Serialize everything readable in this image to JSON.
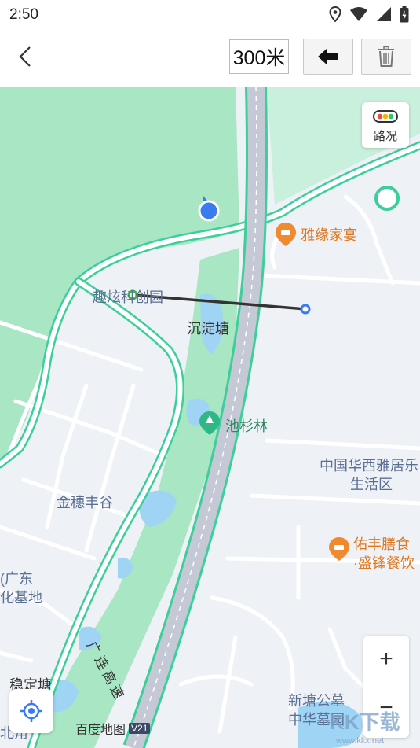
{
  "status_bar": {
    "time": "2:50"
  },
  "toolbar": {
    "distance": "300米"
  },
  "map": {
    "labels": {
      "yayuan": "雅缘家宴",
      "quxuan": "趣炫科创园",
      "chendiantang": "沉淀塘",
      "chishanlin": "池杉林",
      "huaxi_line1": "中国华西雅居乐",
      "huaxi_line2": "生活区",
      "jinsui": "金穗丰谷",
      "youfeng_line1": "佑丰膳食",
      "youfeng_line2": "·盛锋餐饮",
      "guangdong_line1": "(广东",
      "guangdong_line2": "化基地",
      "guanglian": "广连高速",
      "wendingtang": "稳定塘",
      "beijiao": "北角",
      "xintang_line1": "新塘公墓",
      "xintang_line2": "中华墓园"
    },
    "traffic_label": "路况",
    "logo_text": "百度地图",
    "logo_version": "V21",
    "watermark": "KK下载",
    "watermark_url": "www.kkx.net"
  },
  "controls": {
    "zoom_in": "+",
    "zoom_out": "−"
  },
  "colors": {
    "park": "#a8e6c4",
    "road_outline": "#3ccf9a",
    "highway": "#c5c9d6",
    "marker": "#3a7cf0",
    "poi_orange": "#f08a30"
  },
  "icons": [
    "back-arrow-icon",
    "undo-arrow-icon",
    "trash-icon",
    "traffic-light-icon",
    "locate-icon",
    "location-icon",
    "wifi-icon",
    "signal-icon",
    "battery-icon"
  ]
}
